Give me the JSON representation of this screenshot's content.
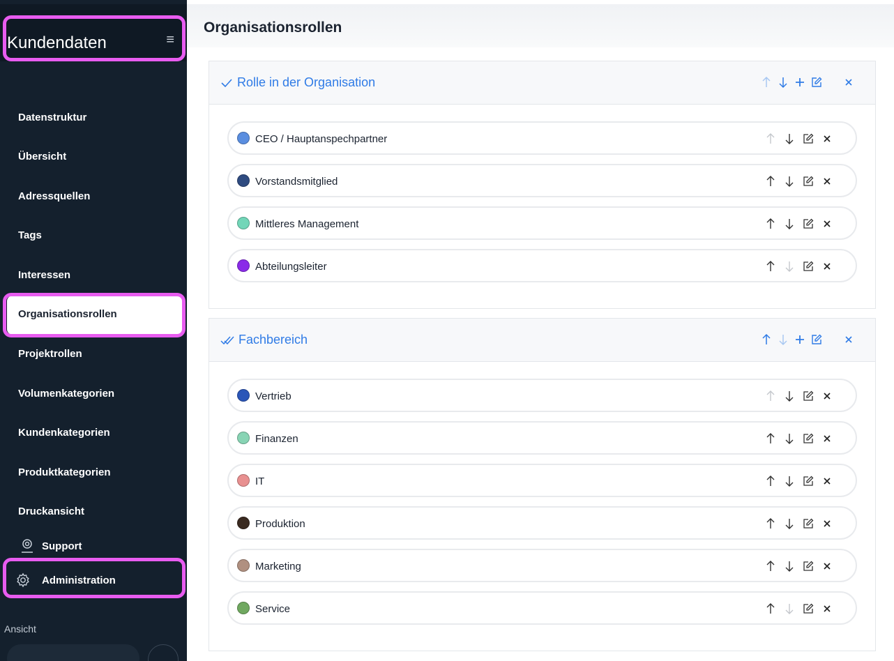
{
  "app": {
    "title": "Kundendaten"
  },
  "sidebar": {
    "items": [
      {
        "label": "Datenstruktur"
      },
      {
        "label": "Übersicht"
      },
      {
        "label": "Adressquellen"
      },
      {
        "label": "Tags"
      },
      {
        "label": "Interessen"
      },
      {
        "label": "Organisationsrollen",
        "active": true
      },
      {
        "label": "Projektrollen"
      },
      {
        "label": "Volumenkategorien"
      },
      {
        "label": "Kundenkategorien"
      },
      {
        "label": "Produktkategorien"
      },
      {
        "label": "Druckansicht"
      }
    ],
    "support_label": "Support",
    "administration_label": "Administration",
    "ansicht_label": "Ansicht"
  },
  "page": {
    "title": "Organisationsrollen"
  },
  "groups": [
    {
      "title": "Rolle in der Organisation",
      "icon": "check-icon",
      "items": [
        {
          "label": "CEO / Hauptanspechpartner",
          "color": "#5a8ee0"
        },
        {
          "label": "Vorstandsmitglied",
          "color": "#2f4b80"
        },
        {
          "label": "Mittleres Management",
          "color": "#72d6b8"
        },
        {
          "label": "Abteilungsleiter",
          "color": "#8a2be8"
        }
      ]
    },
    {
      "title": "Fachbereich",
      "icon": "double-check-icon",
      "items": [
        {
          "label": "Vertrieb",
          "color": "#2b56b8"
        },
        {
          "label": "Finanzen",
          "color": "#88d4b4"
        },
        {
          "label": "IT",
          "color": "#e89090"
        },
        {
          "label": "Produktion",
          "color": "#3a2a20"
        },
        {
          "label": "Marketing",
          "color": "#b09080"
        },
        {
          "label": "Service",
          "color": "#70a860"
        }
      ]
    }
  ],
  "colors": {
    "accent": "#2f7be6",
    "sidebar": "#14202d",
    "highlight": "#e85cf0"
  }
}
